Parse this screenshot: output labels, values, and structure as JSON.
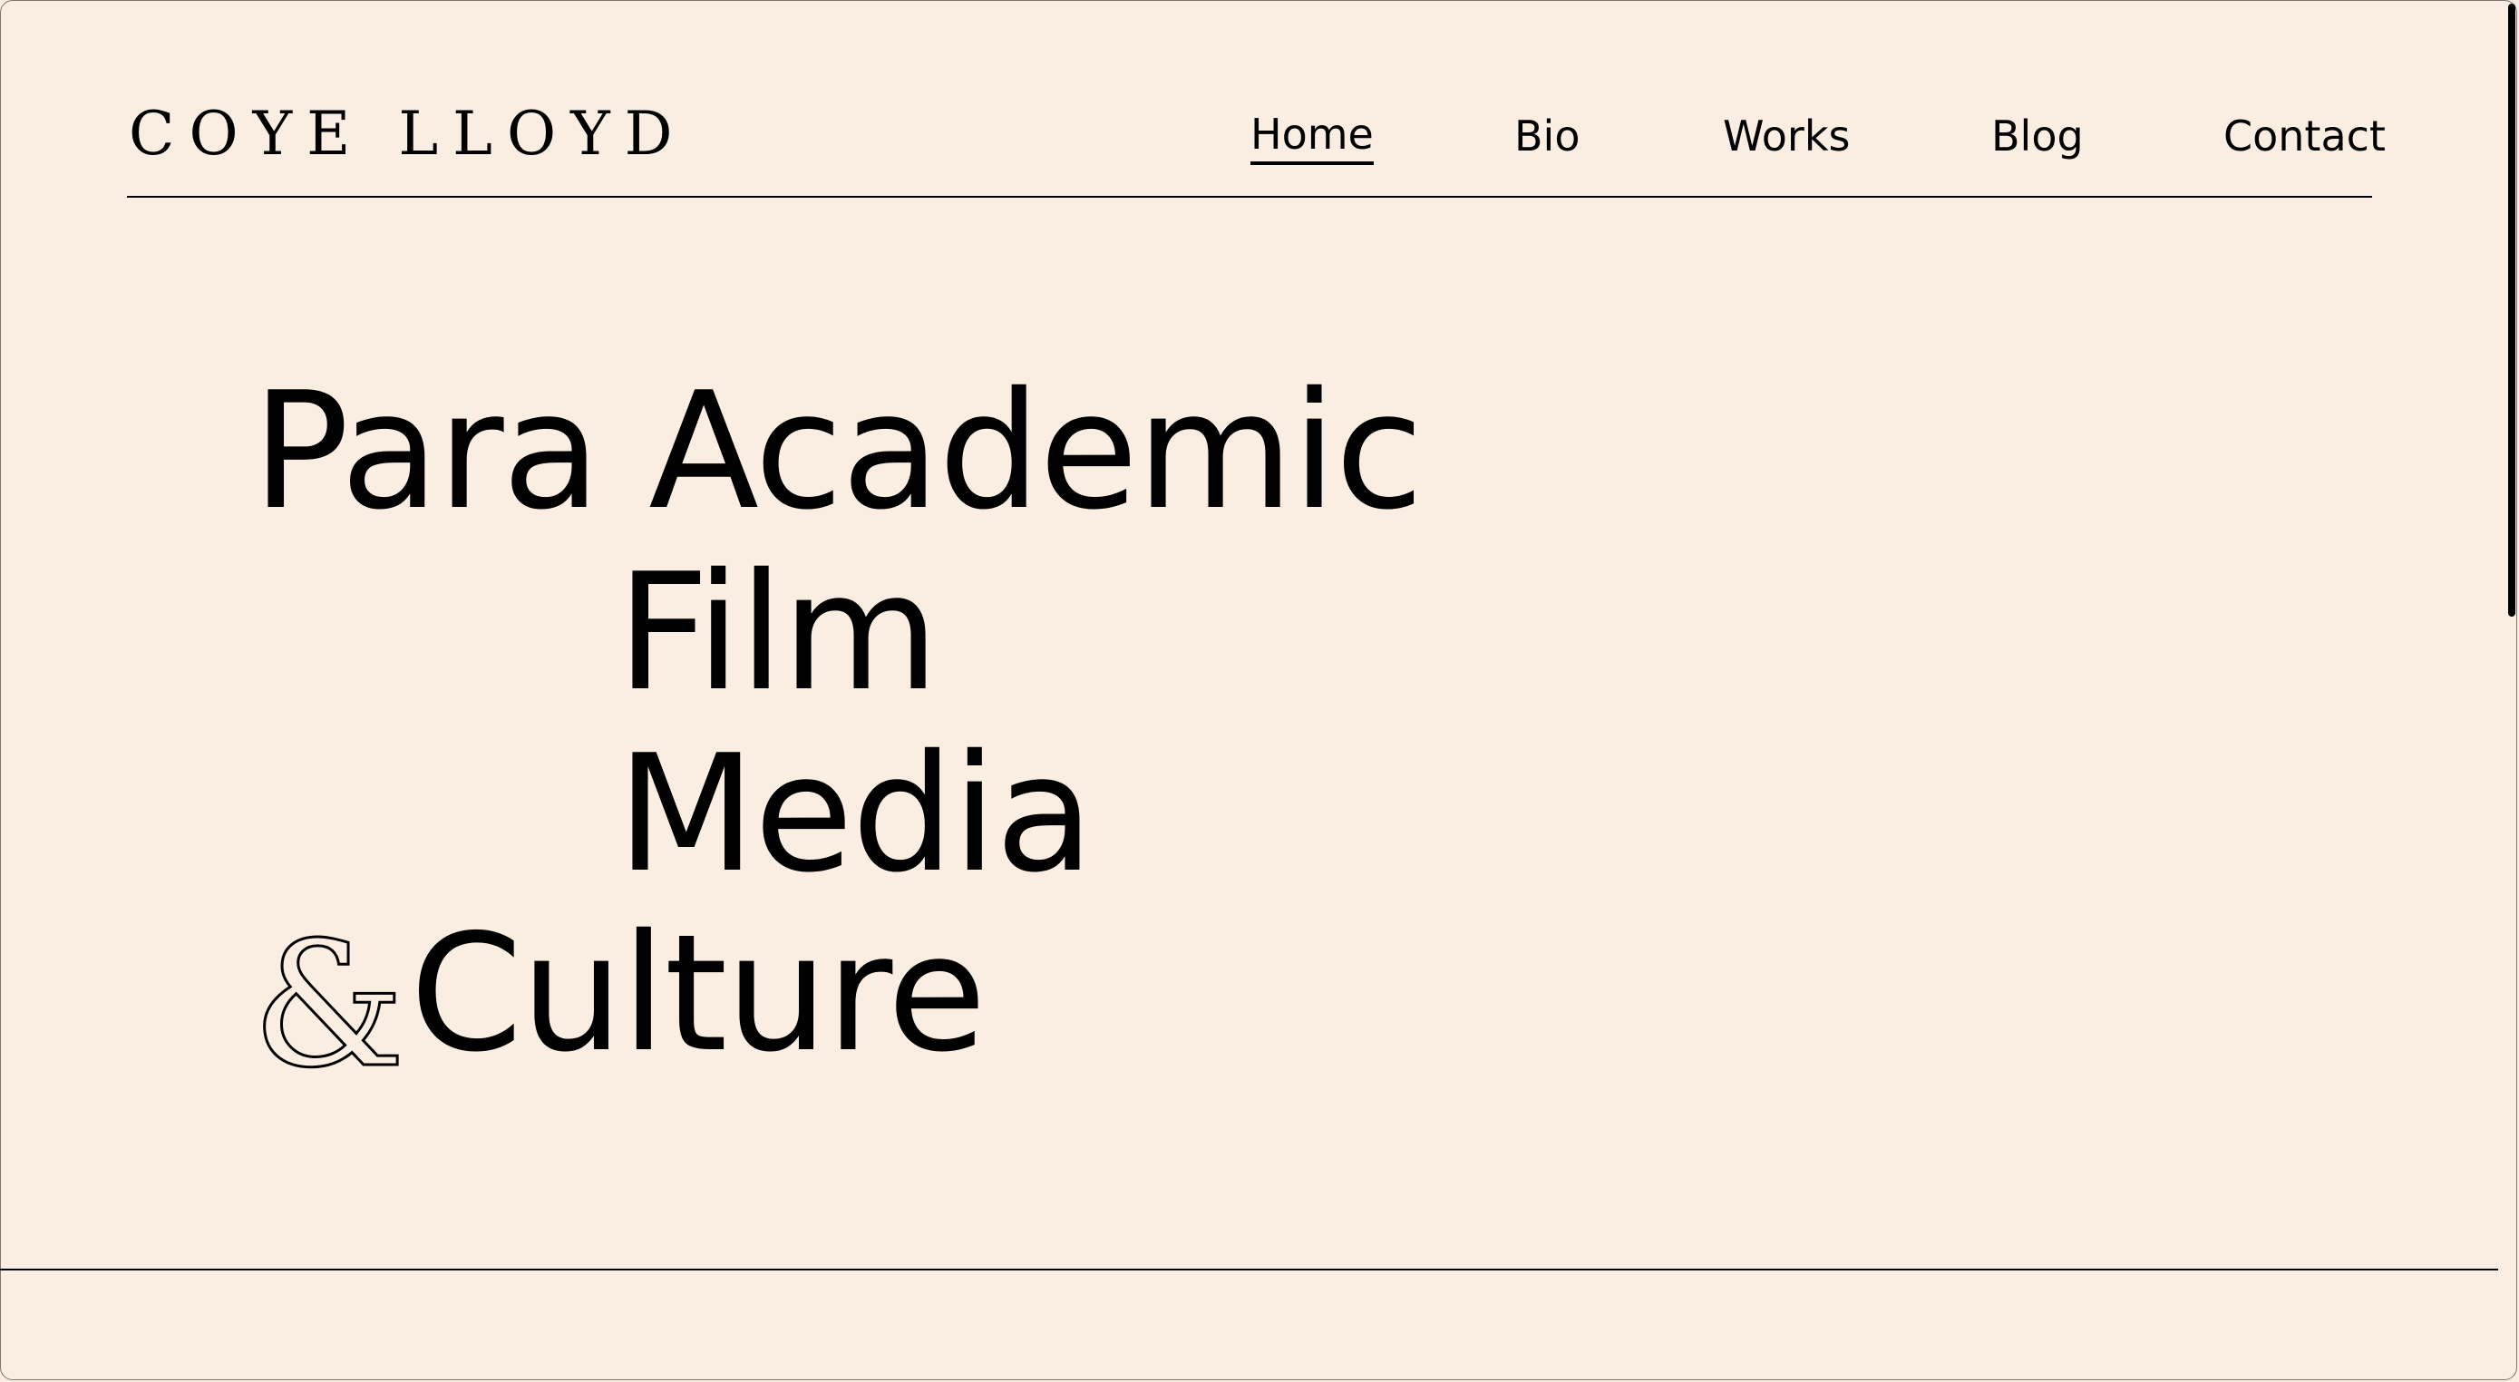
{
  "site": {
    "logo": "COYE LLOYD"
  },
  "nav": {
    "items": [
      {
        "label": "Home",
        "active": true
      },
      {
        "label": "Bio",
        "active": false
      },
      {
        "label": "Works",
        "active": false
      },
      {
        "label": "Blog",
        "active": false
      },
      {
        "label": "Contact",
        "active": false
      }
    ]
  },
  "hero": {
    "line1": "Para Academic",
    "line2": "Film",
    "line3": "Media",
    "ampersand": "&",
    "line4": "Culture"
  },
  "colors": {
    "background": "#faede1",
    "text": "#000000"
  }
}
